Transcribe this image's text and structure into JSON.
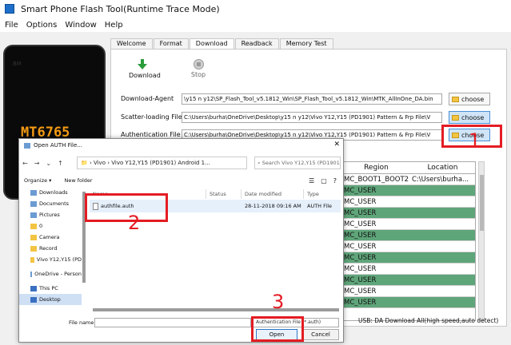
{
  "window": {
    "title": "Smart Phone Flash Tool(Runtime Trace Mode)"
  },
  "menu": [
    "File",
    "Options",
    "Window",
    "Help"
  ],
  "phone": {
    "chip": "MT6765",
    "brand": "BM"
  },
  "tabs": [
    "Welcome",
    "Format",
    "Download",
    "Readback",
    "Memory Test"
  ],
  "toolbar": {
    "download": "Download",
    "stop": "Stop"
  },
  "fields": {
    "download_agent": {
      "label": "Download-Agent",
      "value": "\\y15 n y12\\SP_Flash_Tool_v5.1812_Win\\SP_Flash_Tool_v5.1812_Win\\MTK_AllInOne_DA.bin",
      "button": "choose"
    },
    "scatter": {
      "label": "Scatter-loading File",
      "value": "C:\\Users\\burha\\OneDrive\\Desktop\\y15 n y12\\Vivo Y12,Y15 (PD1901) Pattern & Frp File\\V",
      "button": "choose"
    },
    "auth": {
      "label": "Authentication File",
      "value": "C:\\Users\\burha\\OneDrive\\Desktop\\y15 n y12\\Vivo Y12,Y15 (PD1901) Pattern & Frp File\\V",
      "button": "choose"
    }
  },
  "grid": {
    "headers": [
      "Region",
      "Location"
    ],
    "rows": [
      {
        "region": "MC_BOOT1_BOOT2",
        "location": "C:\\Users\\burha..."
      },
      {
        "region": "MC_USER",
        "location": ""
      },
      {
        "region": "MC_USER",
        "location": ""
      },
      {
        "region": "MC_USER",
        "location": ""
      },
      {
        "region": "MC_USER",
        "location": ""
      },
      {
        "region": "MC_USER",
        "location": ""
      },
      {
        "region": "MC_USER",
        "location": ""
      },
      {
        "region": "MC_USER",
        "location": ""
      },
      {
        "region": "MC_USER",
        "location": ""
      },
      {
        "region": "MC_USER",
        "location": ""
      },
      {
        "region": "MC_USER",
        "location": ""
      },
      {
        "region": "MC_USER",
        "location": ""
      }
    ]
  },
  "status": "USB: DA Download All(high speed,auto detect)",
  "annotations": [
    "1",
    "2",
    "3"
  ],
  "dialog": {
    "title": "Open AUTH File...",
    "address": [
      "Vivo",
      "Vivo Y12,Y15 (PD1901) Android 1..."
    ],
    "search_placeholder": "Search Vivo Y12,Y15 (PD1901) Pattern...",
    "organize": "Organize ▾",
    "new_folder": "New folder",
    "nav_items": [
      {
        "label": "Downloads",
        "pinned": true
      },
      {
        "label": "Documents",
        "pinned": true
      },
      {
        "label": "Pictures",
        "pinned": true
      },
      {
        "label": "0"
      },
      {
        "label": "Camera"
      },
      {
        "label": "Record"
      },
      {
        "label": "Vivo Y12,Y15 (PD"
      },
      {
        "label": "OneDrive - Person"
      },
      {
        "label": "This PC"
      },
      {
        "label": "Desktop"
      }
    ],
    "columns": [
      "Name",
      "Status",
      "Date modified",
      "Type"
    ],
    "files": [
      {
        "name": "authfile.auth",
        "status": "",
        "date": "28-11-2018 09:16 AM",
        "type": "AUTH File"
      }
    ],
    "file_name_label": "File name:",
    "filter": "Authentication File (*.auth)",
    "open": "Open",
    "cancel": "Cancel"
  },
  "colors": {
    "accent": "#e41c23",
    "green_row": "#5fa57a",
    "chip_text": "#f39a14"
  }
}
